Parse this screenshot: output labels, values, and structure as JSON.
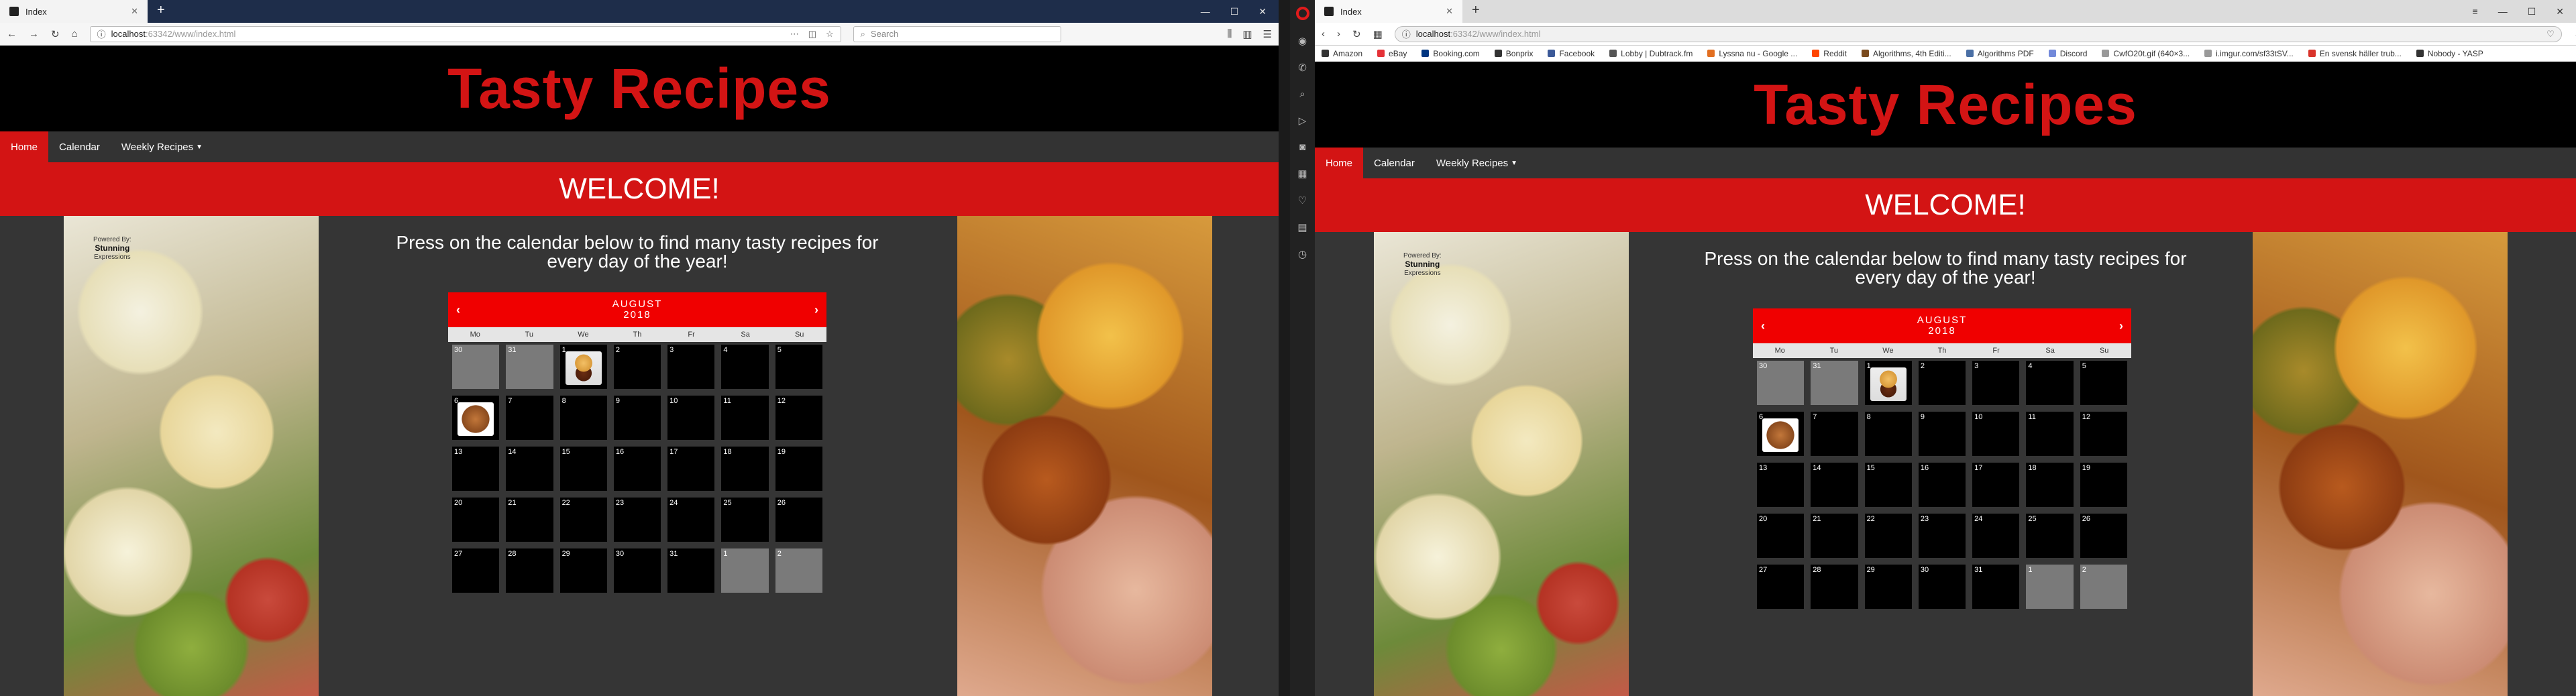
{
  "left_window": {
    "tab_title": "Index",
    "url_host": "localhost",
    "url_path": ":63342/www/index.html",
    "search_placeholder": "Search"
  },
  "right_window": {
    "tab_title": "Index",
    "url_host": "localhost",
    "url_path": ":63342/www/index.html",
    "bookmarks": [
      {
        "label": "Amazon",
        "color": "#333333"
      },
      {
        "label": "eBay",
        "color": "#e53238"
      },
      {
        "label": "Booking.com",
        "color": "#003580"
      },
      {
        "label": "Bonprix",
        "color": "#333333"
      },
      {
        "label": "Facebook",
        "color": "#3b5998"
      },
      {
        "label": "Lobby | Dubtrack.fm",
        "color": "#555555"
      },
      {
        "label": "Lyssna nu - Google ...",
        "color": "#e26f21"
      },
      {
        "label": "Reddit",
        "color": "#ff4500"
      },
      {
        "label": "Algorithms, 4th Editi...",
        "color": "#7a4b1e"
      },
      {
        "label": "Algorithms PDF",
        "color": "#4a6fa5"
      },
      {
        "label": "Discord",
        "color": "#7289da"
      },
      {
        "label": "CwfO20t.gif (640×3...",
        "color": "#999999"
      },
      {
        "label": "i.imgur.com/sf33tSV...",
        "color": "#999999"
      },
      {
        "label": "En svensk häller trub...",
        "color": "#d9342b"
      },
      {
        "label": "Nobody - YASP",
        "color": "#333333"
      }
    ]
  },
  "site": {
    "title": "Tasty Recipes",
    "nav": {
      "home": "Home",
      "calendar": "Calendar",
      "weekly": "Weekly Recipes"
    },
    "welcome": "WELCOME!",
    "lead": "Press on the calendar below to find many tasty recipes for every day of the year!",
    "powered_by": "Powered By:",
    "brand_line1": "Stunning",
    "brand_line2": "Expressions",
    "calendar": {
      "month": "AUGUST",
      "year": "2018",
      "weekdays": [
        "Mo",
        "Tu",
        "We",
        "Th",
        "Fr",
        "Sa",
        "Su"
      ],
      "days": [
        [
          "30",
          "31",
          "1",
          "2",
          "3",
          "4",
          "5"
        ],
        [
          "6",
          "7",
          "8",
          "9",
          "10",
          "11",
          "12"
        ],
        [
          "13",
          "14",
          "15",
          "16",
          "17",
          "18",
          "19"
        ],
        [
          "20",
          "21",
          "22",
          "23",
          "24",
          "25",
          "26"
        ],
        [
          "27",
          "28",
          "29",
          "30",
          "31",
          "1",
          "2"
        ]
      ]
    }
  },
  "colors": {
    "accent_red": "#d31414",
    "calendar_red": "#f00000",
    "page_bg": "#353535"
  }
}
